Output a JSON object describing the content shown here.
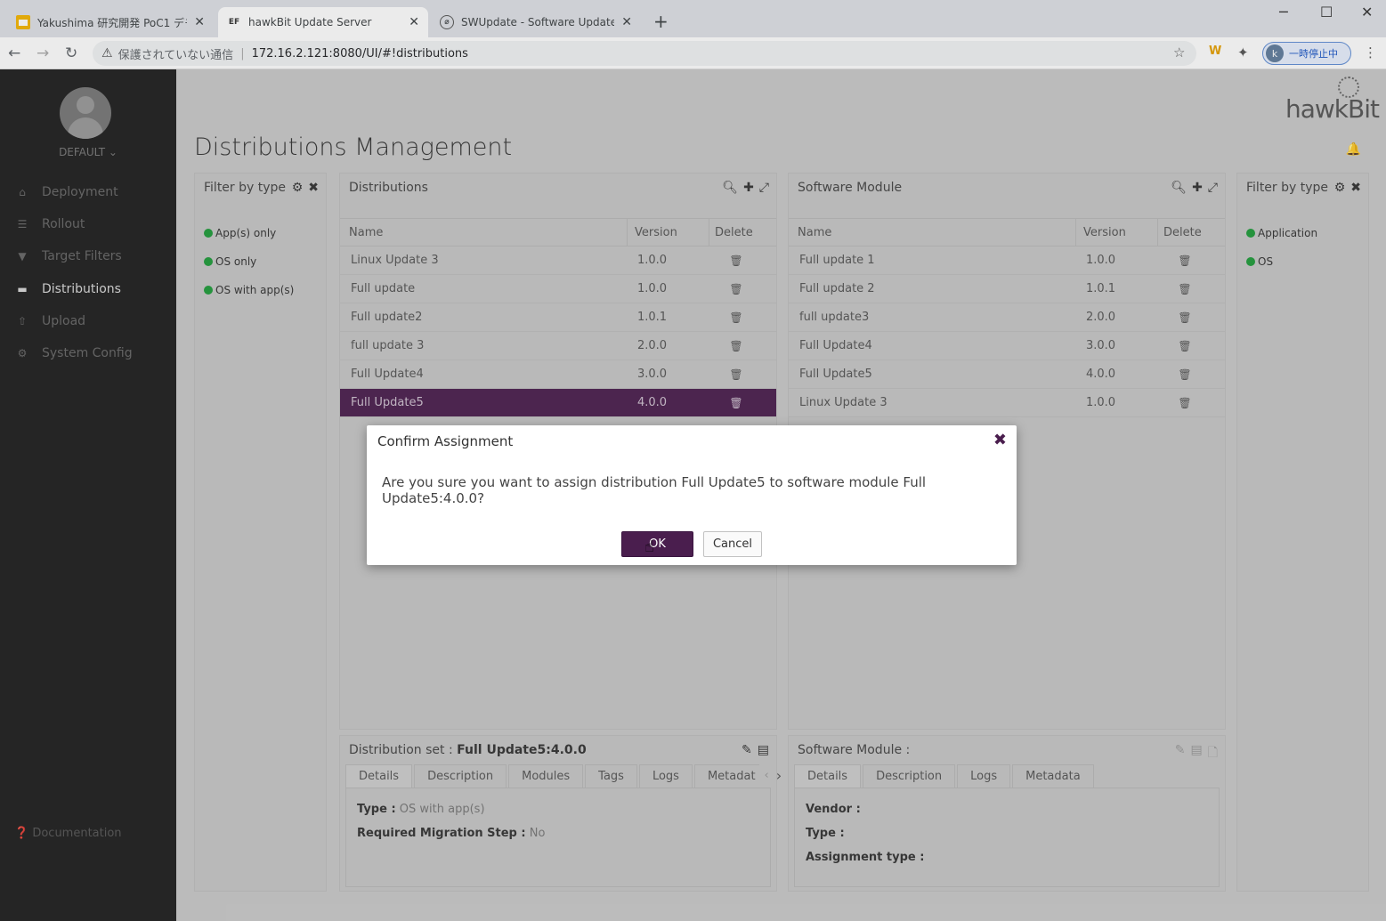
{
  "browser": {
    "tabs": [
      {
        "title": "Yakushima 研究開発 PoC1 デモ/",
        "favicon": "slides-icon",
        "active": false
      },
      {
        "title": "hawkBit Update Server",
        "favicon": "EF",
        "active": true
      },
      {
        "title": "SWUpdate - Software Update for",
        "favicon": "swupdate-icon",
        "active": false
      }
    ],
    "insecure_label": "保護されていない通信",
    "url": "172.16.2.121:8080/UI/#!distributions",
    "profile_initial": "k",
    "profile_status": "一時停止中",
    "ext_w": "W"
  },
  "sidebar": {
    "tenant": "DEFAULT",
    "items": [
      {
        "label": "Deployment",
        "icon": "home-icon"
      },
      {
        "label": "Rollout",
        "icon": "list-icon"
      },
      {
        "label": "Target Filters",
        "icon": "filter-icon"
      },
      {
        "label": "Distributions",
        "icon": "briefcase-icon"
      },
      {
        "label": "Upload",
        "icon": "upload-icon"
      },
      {
        "label": "System Config",
        "icon": "gear-icon"
      }
    ],
    "documentation": "Documentation"
  },
  "header": {
    "title": "Distributions Management",
    "logo": "hawkBit"
  },
  "filter_left": {
    "title": "Filter by type",
    "items": [
      "App(s) only",
      "OS only",
      "OS with app(s)"
    ]
  },
  "distributions": {
    "title": "Distributions",
    "columns": [
      "Name",
      "Version",
      "Delete"
    ],
    "rows": [
      {
        "name": "Linux Update 3",
        "version": "1.0.0"
      },
      {
        "name": "Full update",
        "version": "1.0.0"
      },
      {
        "name": "Full update2",
        "version": "1.0.1"
      },
      {
        "name": "full update 3",
        "version": "2.0.0"
      },
      {
        "name": "Full Update4",
        "version": "3.0.0"
      },
      {
        "name": "Full Update5",
        "version": "4.0.0"
      }
    ]
  },
  "software_module": {
    "title": "Software Module",
    "columns": [
      "Name",
      "Version",
      "Delete"
    ],
    "rows": [
      {
        "name": "Full update 1",
        "version": "1.0.0"
      },
      {
        "name": "Full update 2",
        "version": "1.0.1"
      },
      {
        "name": "full update3",
        "version": "2.0.0"
      },
      {
        "name": "Full Update4",
        "version": "3.0.0"
      },
      {
        "name": "Full Update5",
        "version": "4.0.0"
      },
      {
        "name": "Linux Update 3",
        "version": "1.0.0"
      }
    ]
  },
  "filter_right": {
    "title": "Filter by type",
    "items": [
      "Application",
      "OS"
    ]
  },
  "dist_details": {
    "title_prefix": "Distribution set : ",
    "title_value": "Full Update5:4.0.0",
    "tabs": [
      "Details",
      "Description",
      "Modules",
      "Tags",
      "Logs",
      "Metadat"
    ],
    "type_label": "Type :",
    "type_value": "OS with app(s)",
    "migration_label": "Required Migration Step :",
    "migration_value": "No"
  },
  "sm_details": {
    "title": "Software Module :",
    "tabs": [
      "Details",
      "Description",
      "Logs",
      "Metadata"
    ],
    "vendor_label": "Vendor :",
    "type_label": "Type :",
    "assignment_label": "Assignment type :"
  },
  "dialog": {
    "title": "Confirm Assignment",
    "message": "Are you sure you want to assign distribution Full Update5 to software module Full Update5:4.0.0?",
    "ok": "OK",
    "cancel": "Cancel"
  },
  "colors": {
    "accent": "#4a1e4e",
    "status_green": "#1e9b3a",
    "sidebar_bg": "#1e1e1e"
  }
}
